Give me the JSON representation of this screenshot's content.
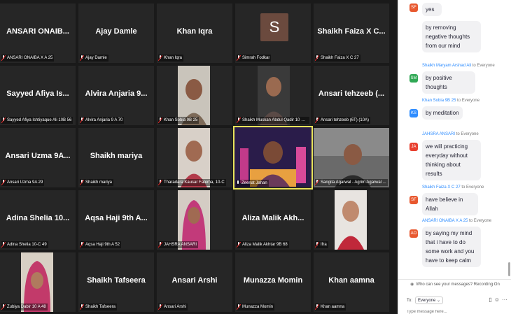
{
  "gallery": {
    "tiles": [
      {
        "name": "ANSARI ONAIB...",
        "label": "ANSARI ONAIBA X A 25"
      },
      {
        "name": "Ajay Damle",
        "label": "Ajay Damle"
      },
      {
        "name": "Khan Iqra",
        "label": "Khan Iqra"
      },
      {
        "name": "S",
        "label": "Simrah Fodkar"
      },
      {
        "name": "Shaikh Faiza X C...",
        "label": "Shaikh Faiza X C 27"
      },
      {
        "name": "Sayyed Afiya Is...",
        "label": "Sayyed Afiya Ishtiyaque Ali 10B 56"
      },
      {
        "name": "Alvira Anjaria 9...",
        "label": "Alvira Anjaria 9 A 70"
      },
      {
        "name": "",
        "label": "Khan Sobia 9B 25"
      },
      {
        "name": "",
        "label": "Shaikh Muskan Abdul Qadir 10 C ..."
      },
      {
        "name": "Ansari tehzeeb (...",
        "label": "Ansari tehzeeb (6T) (10A)"
      },
      {
        "name": "Ansari Uzma 9A...",
        "label": "Ansari Uzma 9A 29"
      },
      {
        "name": "Shaikh mariya",
        "label": "Shaikh mariya"
      },
      {
        "name": "",
        "label": "Tharadara Kausar Fatema, 10-C"
      },
      {
        "name": "",
        "label": "Zeenat Jahan"
      },
      {
        "name": "",
        "label": "Sangita Agarwal - Agrim Agarwal ..."
      },
      {
        "name": "Adina Shelia 10...",
        "label": "Adina Shelia 10-C 49"
      },
      {
        "name": "Aqsa Haji 9th A...",
        "label": "Aqsa Haji 9th A 52"
      },
      {
        "name": "",
        "label": "JAHSRA ANSARI"
      },
      {
        "name": "Aliza Malik Akh...",
        "label": "Aliza Malik Akhtar 9B 68"
      },
      {
        "name": "",
        "label": "Ifra"
      },
      {
        "name": "",
        "label": "Zubiya Dabir 10 A 48"
      },
      {
        "name": "Shaikh Tafseera",
        "label": "Shaikh Tafseera"
      },
      {
        "name": "Ansari Arshi",
        "label": "Ansari Arshi"
      },
      {
        "name": "Munazza Momin",
        "label": "Munazza Momin"
      },
      {
        "name": "Khan aamna",
        "label": "Khan aamna"
      }
    ]
  },
  "chat": {
    "messages": [
      {
        "sender": "",
        "to": "",
        "initials": "SF",
        "avatar_color": "#e8582f",
        "text": "yes"
      },
      {
        "sender": "",
        "to": "",
        "initials": "",
        "avatar_color": "",
        "text": "by removing negative thoughts from our mind"
      },
      {
        "sender": "Shaikh Maryam Arshad Ali",
        "to": "to Everyone",
        "initials": "SM",
        "avatar_color": "#2fa854",
        "text": "by positive thoughts"
      },
      {
        "sender": "Khan Sobia 9B 25",
        "to": "to Everyone",
        "initials": "KS",
        "avatar_color": "#2d8cff",
        "text": "by meditation"
      },
      {
        "sender": "JAHSRA ANSARI",
        "to": "to Everyone",
        "initials": "JA",
        "avatar_color": "#e8402f",
        "text": "we will practicing everyday without thinking about results"
      },
      {
        "sender": "Shaikh Faiza X C 27",
        "to": "to Everyone",
        "initials": "SF",
        "avatar_color": "#e8582f",
        "text": "have believe in Allah"
      },
      {
        "sender": "ANSARI ONAIBA X A 25",
        "to": "to Everyone",
        "initials": "AO",
        "avatar_color": "#e8582f",
        "text": "by saying my mind that i have to do some work and you have to keep calm"
      }
    ],
    "who_can_see": "Who can see your messages? Recording On",
    "to_label": "To:",
    "to_value": "Everyone",
    "placeholder": "Type message here..."
  },
  "colors": {
    "active_speaker_border": "#e8e35a",
    "chat_sender": "#2d8cff",
    "muted_mic": "#e02828"
  }
}
